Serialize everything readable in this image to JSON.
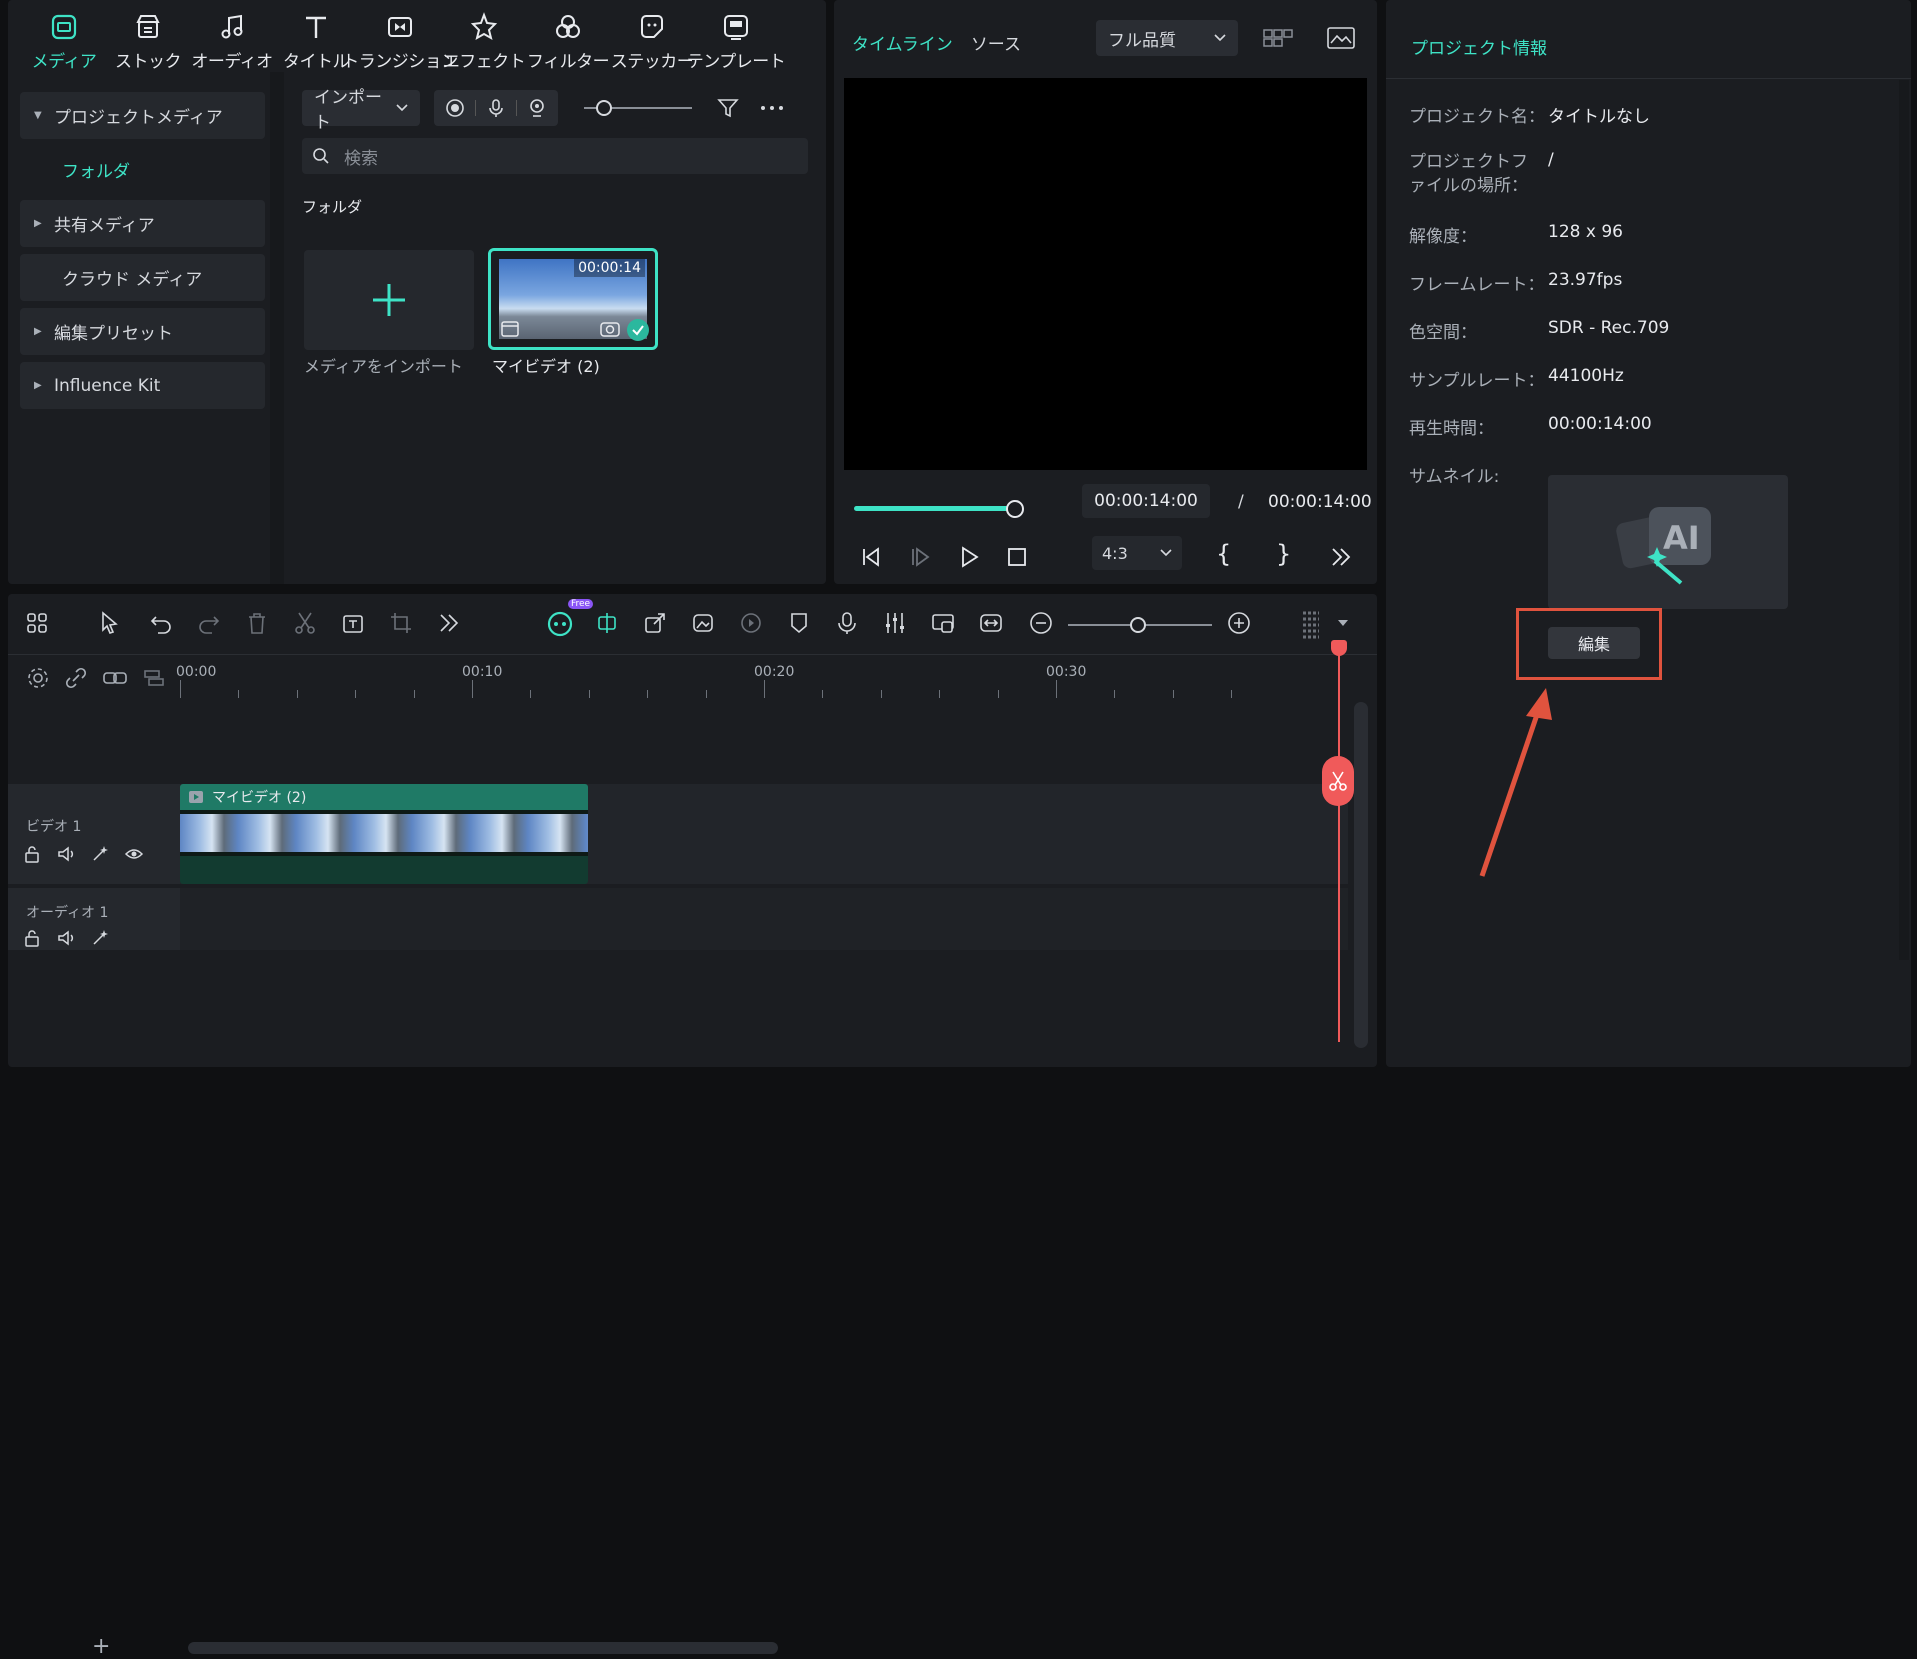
{
  "top_tabs": [
    {
      "label": "メディア",
      "icon": "media-icon"
    },
    {
      "label": "ストック",
      "icon": "stock-icon"
    },
    {
      "label": "オーディオ",
      "icon": "music-note-icon"
    },
    {
      "label": "タイトル",
      "icon": "title-t-icon"
    },
    {
      "label": "トランジション",
      "icon": "transition-icon"
    },
    {
      "label": "エフェクト",
      "icon": "effect-star-icon"
    },
    {
      "label": "フィルター",
      "icon": "filter-icon"
    },
    {
      "label": "ステッカー",
      "icon": "sticker-icon"
    },
    {
      "label": "テンプレート",
      "icon": "template-icon"
    }
  ],
  "sidebar": {
    "items": [
      {
        "label": "プロジェクトメディア"
      },
      {
        "label": "フォルダ"
      },
      {
        "label": "共有メディア"
      },
      {
        "label": "クラウド メディア"
      },
      {
        "label": "編集プリセット"
      },
      {
        "label": "Influence Kit"
      }
    ]
  },
  "media": {
    "import_label": "インポート",
    "search_placeholder": "検索",
    "folder_title": "フォルダ",
    "import_tile_label": "メディアをインポート",
    "clip_label": "マイビデオ (2)",
    "clip_duration": "00:00:14"
  },
  "preview": {
    "tab_timeline": "タイムライン",
    "tab_source": "ソース",
    "quality": "フル品質",
    "current_time": "00:00:14:00",
    "separator": "/",
    "total_time": "00:00:14:00",
    "ratio": "4:3",
    "bracket_in": "{",
    "bracket_out": "}",
    "progress_fraction": 1.0
  },
  "info": {
    "title": "プロジェクト情報",
    "rows": [
      {
        "label": "プロジェクト名：",
        "value": "タイトルなし"
      },
      {
        "label": "プロジェクトファイルの場所：",
        "value": "/"
      },
      {
        "label": "解像度：",
        "value": "128 x 96"
      },
      {
        "label": "フレームレート：",
        "value": "23.97fps"
      },
      {
        "label": "色空間：",
        "value": "SDR - Rec.709"
      },
      {
        "label": "サンプルレート：",
        "value": "44100Hz"
      },
      {
        "label": "再生時間：",
        "value": "00:00:14:00"
      },
      {
        "label": "サムネイル:",
        "value": ""
      }
    ],
    "edit_button": "編集"
  },
  "timeline": {
    "free_badge": "Free",
    "ruler": [
      "00:00",
      "00:10",
      "00:20",
      "00:30"
    ],
    "video_track_label": "ビデオ 1",
    "audio_track_label": "オーディオ 1",
    "clip_label": "マイビデオ (2)",
    "add_track": "+"
  },
  "colors": {
    "accent": "#3ee3c6",
    "playhead": "#f05a5a",
    "annotation": "#e0533e"
  }
}
